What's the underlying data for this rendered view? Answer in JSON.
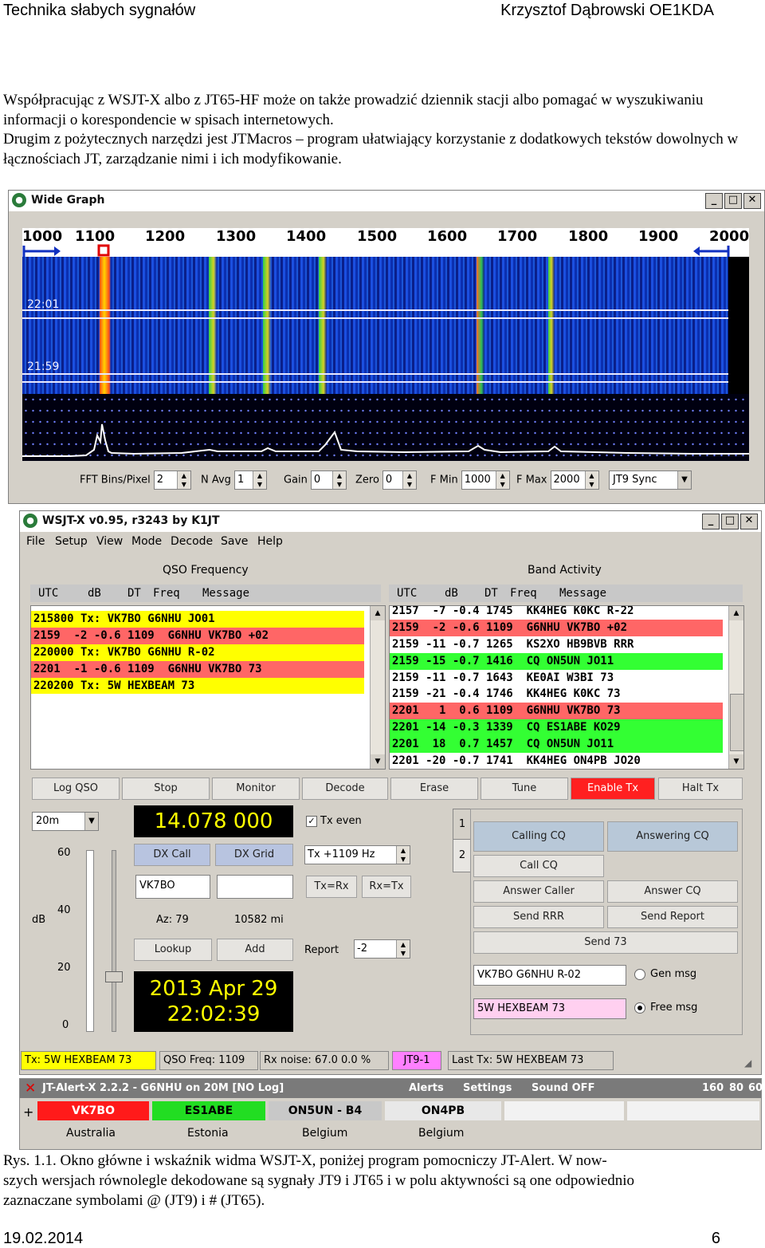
{
  "page": {
    "header_left": "Technika słabych sygnałów",
    "header_right": "Krzysztof Dąbrowski OE1KDA",
    "intro": [
      "Współpracując z WSJT-X albo z JT65-HF może on także prowadzić dziennik stacji albo pomagać w wyszukiwaniu informacji o korespondencie w spisach internetowych.",
      "Drugim z pożytecznych narzędzi jest JTMacros – program ułatwiający korzystanie z dodatkowych tekstów dowolnych w łącznościach JT, zarządzanie nimi i ich modyfikowanie."
    ],
    "caption": [
      "Rys. 1.1. Okno główne i wskaźnik widma WSJT-X, poniżej program pomocniczy JT-Alert. W now-",
      "szych wersjach równolegle dekodowane są sygnały JT9 i JT65 i w polu aktywności są one odpowiednio",
      "zaznaczane symbolami @ (JT9) i # (JT65)."
    ],
    "footer_left": "19.02.2014",
    "footer_right": "6"
  },
  "wide_graph": {
    "title": "Wide Graph",
    "scale_ticks": [
      "1000",
      "1100",
      "1200",
      "1300",
      "1400",
      "1500",
      "1600",
      "1700",
      "1800",
      "1900",
      "2000"
    ],
    "timestamps": [
      "22:01",
      "21:59"
    ],
    "controls": {
      "fft_label": "FFT Bins/Pixel",
      "fft_value": "2",
      "navg_label": "N Avg",
      "navg_value": "1",
      "gain_label": "Gain",
      "gain_value": "0",
      "zero_label": "Zero",
      "zero_value": "0",
      "fmin_label": "F Min",
      "fmin_value": "1000",
      "fmax_label": "F Max",
      "fmax_value": "2000",
      "mode_value": "JT9 Sync"
    }
  },
  "wsjtx": {
    "title": "WSJT-X   v0.95, r3243   by K1JT",
    "menu": [
      "File",
      "Setup",
      "View",
      "Mode",
      "Decode",
      "Save",
      "Help"
    ],
    "qso_title": "QSO Frequency",
    "band_title": "Band Activity",
    "headers": {
      "utc": "UTC",
      "db": "dB",
      "dt": "DT",
      "freq": "Freq",
      "msg": "Message"
    },
    "qso_rows": [
      {
        "text": "215800 Tx: VK7BO G6NHU JO01",
        "bg": "#ffff00"
      },
      {
        "text": "2159  -2 -0.6 1109  G6NHU VK7BO +02",
        "bg": "#ff6666"
      },
      {
        "text": "220000 Tx: VK7BO G6NHU R-02",
        "bg": "#ffff00"
      },
      {
        "text": "2201  -1 -0.6 1109  G6NHU VK7BO 73",
        "bg": "#ff6666"
      },
      {
        "text": "220200 Tx: 5W HEXBEAM 73",
        "bg": "#ffff00"
      }
    ],
    "band_rows": [
      {
        "text": "2157  -7 -0.4 1745  KK4HEG K0KC R-22",
        "bg": "#ffffff"
      },
      {
        "text": "2159  -2 -0.6 1109  G6NHU VK7BO +02",
        "bg": "#ff6666"
      },
      {
        "text": "2159 -11 -0.7 1265  KS2XO HB9BVB RRR",
        "bg": "#ffffff"
      },
      {
        "text": "2159 -15 -0.7 1416  CQ ON5UN JO11",
        "bg": "#33ff33"
      },
      {
        "text": "2159 -11 -0.7 1643  KE0AI W3BI 73",
        "bg": "#ffffff"
      },
      {
        "text": "2159 -21 -0.4 1746  KK4HEG K0KC 73",
        "bg": "#ffffff"
      },
      {
        "text": "2201   1  0.6 1109  G6NHU VK7BO 73",
        "bg": "#ff6666"
      },
      {
        "text": "2201 -14 -0.3 1339  CQ ES1ABE KO29",
        "bg": "#33ff33"
      },
      {
        "text": "2201  18  0.7 1457  CQ ON5UN JO11",
        "bg": "#33ff33"
      },
      {
        "text": "2201 -20 -0.7 1741  KK4HEG ON4PB JO20",
        "bg": "#ffffff"
      }
    ],
    "buttons": [
      "Log QSO",
      "Stop",
      "Monitor",
      "Decode",
      "Erase",
      "Tune",
      "Enable Tx",
      "Halt Tx"
    ],
    "band": "20m",
    "dial_freq": "14.078 000",
    "tx_even": "Tx even",
    "dx_call_label": "DX Call",
    "dx_grid_label": "DX Grid",
    "dx_call_value": "VK7BO",
    "tx_freq": "Tx +1109  Hz",
    "txrx": "Tx=Rx",
    "rxtx": "Rx=Tx",
    "az": "Az: 79",
    "dist": "10582 mi",
    "lookup": "Lookup",
    "add": "Add",
    "report_label": "Report",
    "report_value": "-2",
    "date": "2013 Apr 29",
    "time": "22:02:39",
    "db_label": "dB",
    "meter_ticks": [
      "60",
      "40",
      "20",
      "0"
    ],
    "tabs": [
      "1",
      "2"
    ],
    "macros": {
      "calling_cq": "Calling CQ",
      "answering_cq": "Answering CQ",
      "call_cq": "Call CQ",
      "answer_caller": "Answer Caller",
      "answer_cq": "Answer CQ",
      "send_rrr": "Send RRR",
      "send_report": "Send Report",
      "send_73": "Send 73",
      "gen_msg_value": "VK7BO G6NHU R-02",
      "gen_msg": "Gen msg",
      "free_msg_value": "5W HEXBEAM 73",
      "free_msg": "Free msg"
    },
    "status": {
      "tx": "Tx: 5W HEXBEAM 73",
      "qso_freq": "QSO Freq: 1109",
      "rx_noise": "Rx noise: 67.0  0.0 %",
      "mode": "JT9-1",
      "last_tx": "Last Tx: 5W HEXBEAM 73"
    }
  },
  "jtalert": {
    "title": "JT-Alert-X 2.2.2 - G6NHU on 20M [NO Log]",
    "menu": [
      "Alerts",
      "Settings",
      "Sound OFF"
    ],
    "numbers": [
      "160",
      "80",
      "60"
    ],
    "calls": [
      {
        "call": "VK7BO",
        "country": "Australia",
        "bg": "#ff1a1a",
        "fg": "#ffffff"
      },
      {
        "call": "ES1ABE",
        "country": "Estonia",
        "bg": "#22dd22",
        "fg": "#000000"
      },
      {
        "call": "ON5UN - B4",
        "country": "Belgium",
        "bg": "#c8c8c8",
        "fg": "#000000"
      },
      {
        "call": "ON4PB",
        "country": "Belgium",
        "bg": "#e8e8e8",
        "fg": "#000000"
      }
    ]
  },
  "colors": {
    "qso_yellow": "#ffff00",
    "decode_red": "#ff6666",
    "cq_green": "#33ff33",
    "enable_tx": "#ff2020",
    "freq_display": "#ffff00"
  }
}
